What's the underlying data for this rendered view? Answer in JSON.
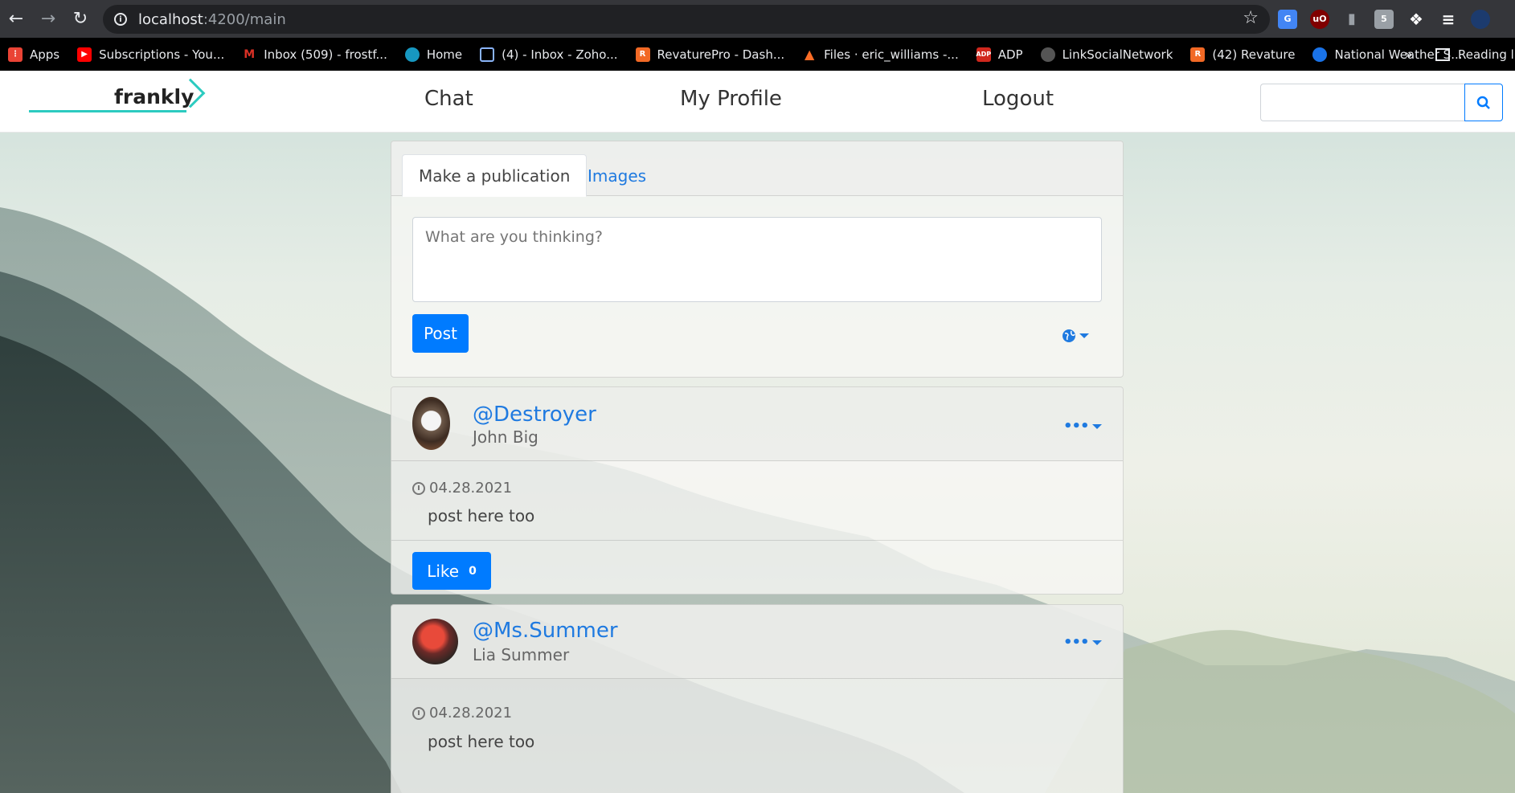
{
  "browser": {
    "url_host": "localhost",
    "url_path": ":4200/main",
    "bookmarks": [
      {
        "label": "Apps",
        "icon": "apps-grid-icon",
        "color": "#ea4335"
      },
      {
        "label": "Subscriptions - You...",
        "icon": "youtube-icon",
        "color": "#ff0000"
      },
      {
        "label": "Inbox (509) - frostf...",
        "icon": "gmail-icon",
        "color": "#d93025"
      },
      {
        "label": "Home",
        "icon": "salesforce-cloud-icon",
        "color": "#1798c1"
      },
      {
        "label": "(4) - Inbox - Zoho...",
        "icon": "zoho-mail-icon",
        "color": "#8ab4f8"
      },
      {
        "label": "RevaturePro - Dash...",
        "icon": "revature-icon",
        "color": "#f26925"
      },
      {
        "label": "Files · eric_williams -...",
        "icon": "gitlab-icon",
        "color": "#fc6d26"
      },
      {
        "label": "ADP",
        "icon": "adp-icon",
        "color": "#d0271d"
      },
      {
        "label": "LinkSocialNetwork",
        "icon": "github-icon",
        "color": "#555555"
      },
      {
        "label": "(42) Revature",
        "icon": "revature-icon",
        "color": "#f26925"
      },
      {
        "label": "National Weather S...",
        "icon": "weather-icon",
        "color": "#1a73e8"
      }
    ],
    "reading_list_label": "Reading lis"
  },
  "app": {
    "brand": "frankly",
    "nav": {
      "chat": "Chat",
      "profile": "My Profile",
      "logout": "Logout"
    },
    "search": {
      "value": "",
      "placeholder": ""
    },
    "compose": {
      "tab_active": "Make a publication",
      "tab_images": "Images",
      "placeholder": "What are you thinking?",
      "post_label": "Post"
    },
    "posts": [
      {
        "handle": "@Destroyer",
        "name": "John Big",
        "date": "04.28.2021",
        "text": "post here too",
        "like_label": "Like",
        "likes": "0"
      },
      {
        "handle": "@Ms.Summer",
        "name": "Lia Summer",
        "date": "04.28.2021",
        "text": "post here too"
      }
    ]
  },
  "colors": {
    "primary": "#007bff",
    "link": "#1f7ae0",
    "brand_accent": "#2ccbc0"
  }
}
